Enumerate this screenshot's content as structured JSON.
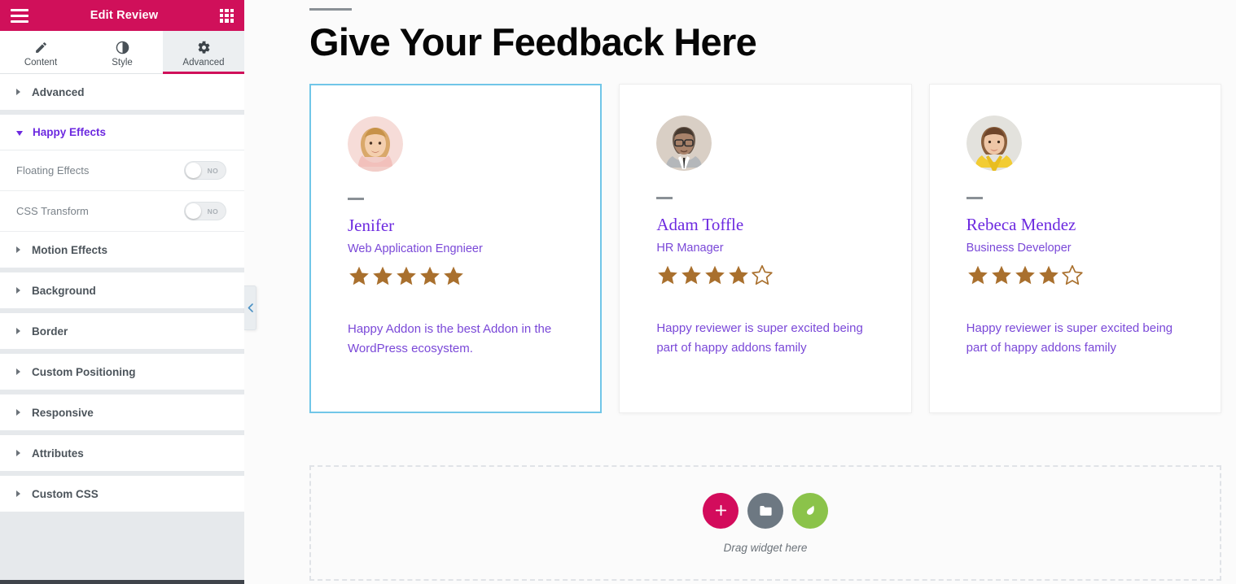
{
  "panel": {
    "header": {
      "title": "Edit Review",
      "menu_icon": "hamburger-icon",
      "grid_icon": "grid-apps-icon",
      "background_color": "#d0105a"
    },
    "tabs": [
      {
        "label": "Content",
        "icon": "pencil-icon",
        "active": false
      },
      {
        "label": "Style",
        "icon": "contrast-half-circle-icon",
        "active": false
      },
      {
        "label": "Advanced",
        "icon": "gear-icon",
        "active": true
      }
    ],
    "sections": [
      {
        "label": "Advanced",
        "open": false
      },
      {
        "label": "Happy Effects",
        "open": true
      },
      {
        "label": "Motion Effects",
        "open": false
      },
      {
        "label": "Background",
        "open": false
      },
      {
        "label": "Border",
        "open": false
      },
      {
        "label": "Custom Positioning",
        "open": false
      },
      {
        "label": "Responsive",
        "open": false
      },
      {
        "label": "Attributes",
        "open": false
      },
      {
        "label": "Custom CSS",
        "open": false
      }
    ],
    "happy_effects_controls": [
      {
        "label": "Floating Effects",
        "value": "NO"
      },
      {
        "label": "CSS Transform",
        "value": "NO"
      }
    ],
    "collapse_handle_icon": "chevron-left-icon"
  },
  "canvas": {
    "heading": "Give Your Feedback Here",
    "reviews": [
      {
        "name": "Jenifer",
        "title": "Web Application Engnieer",
        "rating": 5,
        "max_rating": 5,
        "text": "Happy Addon is the best Addon in the WordPress ecosystem.",
        "avatar_icon": "avatar-woman-blonde",
        "selected": true
      },
      {
        "name": "Adam Toffle",
        "title": "HR Manager",
        "rating": 4,
        "max_rating": 5,
        "text": "Happy reviewer is super excited being part of happy addons family",
        "avatar_icon": "avatar-man-glasses",
        "selected": false
      },
      {
        "name": "Rebeca Mendez",
        "title": "Business Developer",
        "rating": 4,
        "max_rating": 5,
        "text": "Happy reviewer is super excited being part of happy addons family",
        "avatar_icon": "avatar-woman-yellow",
        "selected": false
      }
    ],
    "dropzone": {
      "label": "Drag widget here",
      "buttons": [
        {
          "icon": "plus-icon",
          "color": "#d30c5c",
          "name": "add-widget-button"
        },
        {
          "icon": "folder-icon",
          "color": "#6d7882",
          "name": "template-library-button"
        },
        {
          "icon": "leaf-icon",
          "color": "#8bc34a",
          "name": "happy-addons-button"
        }
      ]
    }
  },
  "colors": {
    "brand_crimson": "#d0105a",
    "accent_purple": "#6d2ae0",
    "star_filled": "#a9702e",
    "selection_blue": "#71c6e8"
  }
}
